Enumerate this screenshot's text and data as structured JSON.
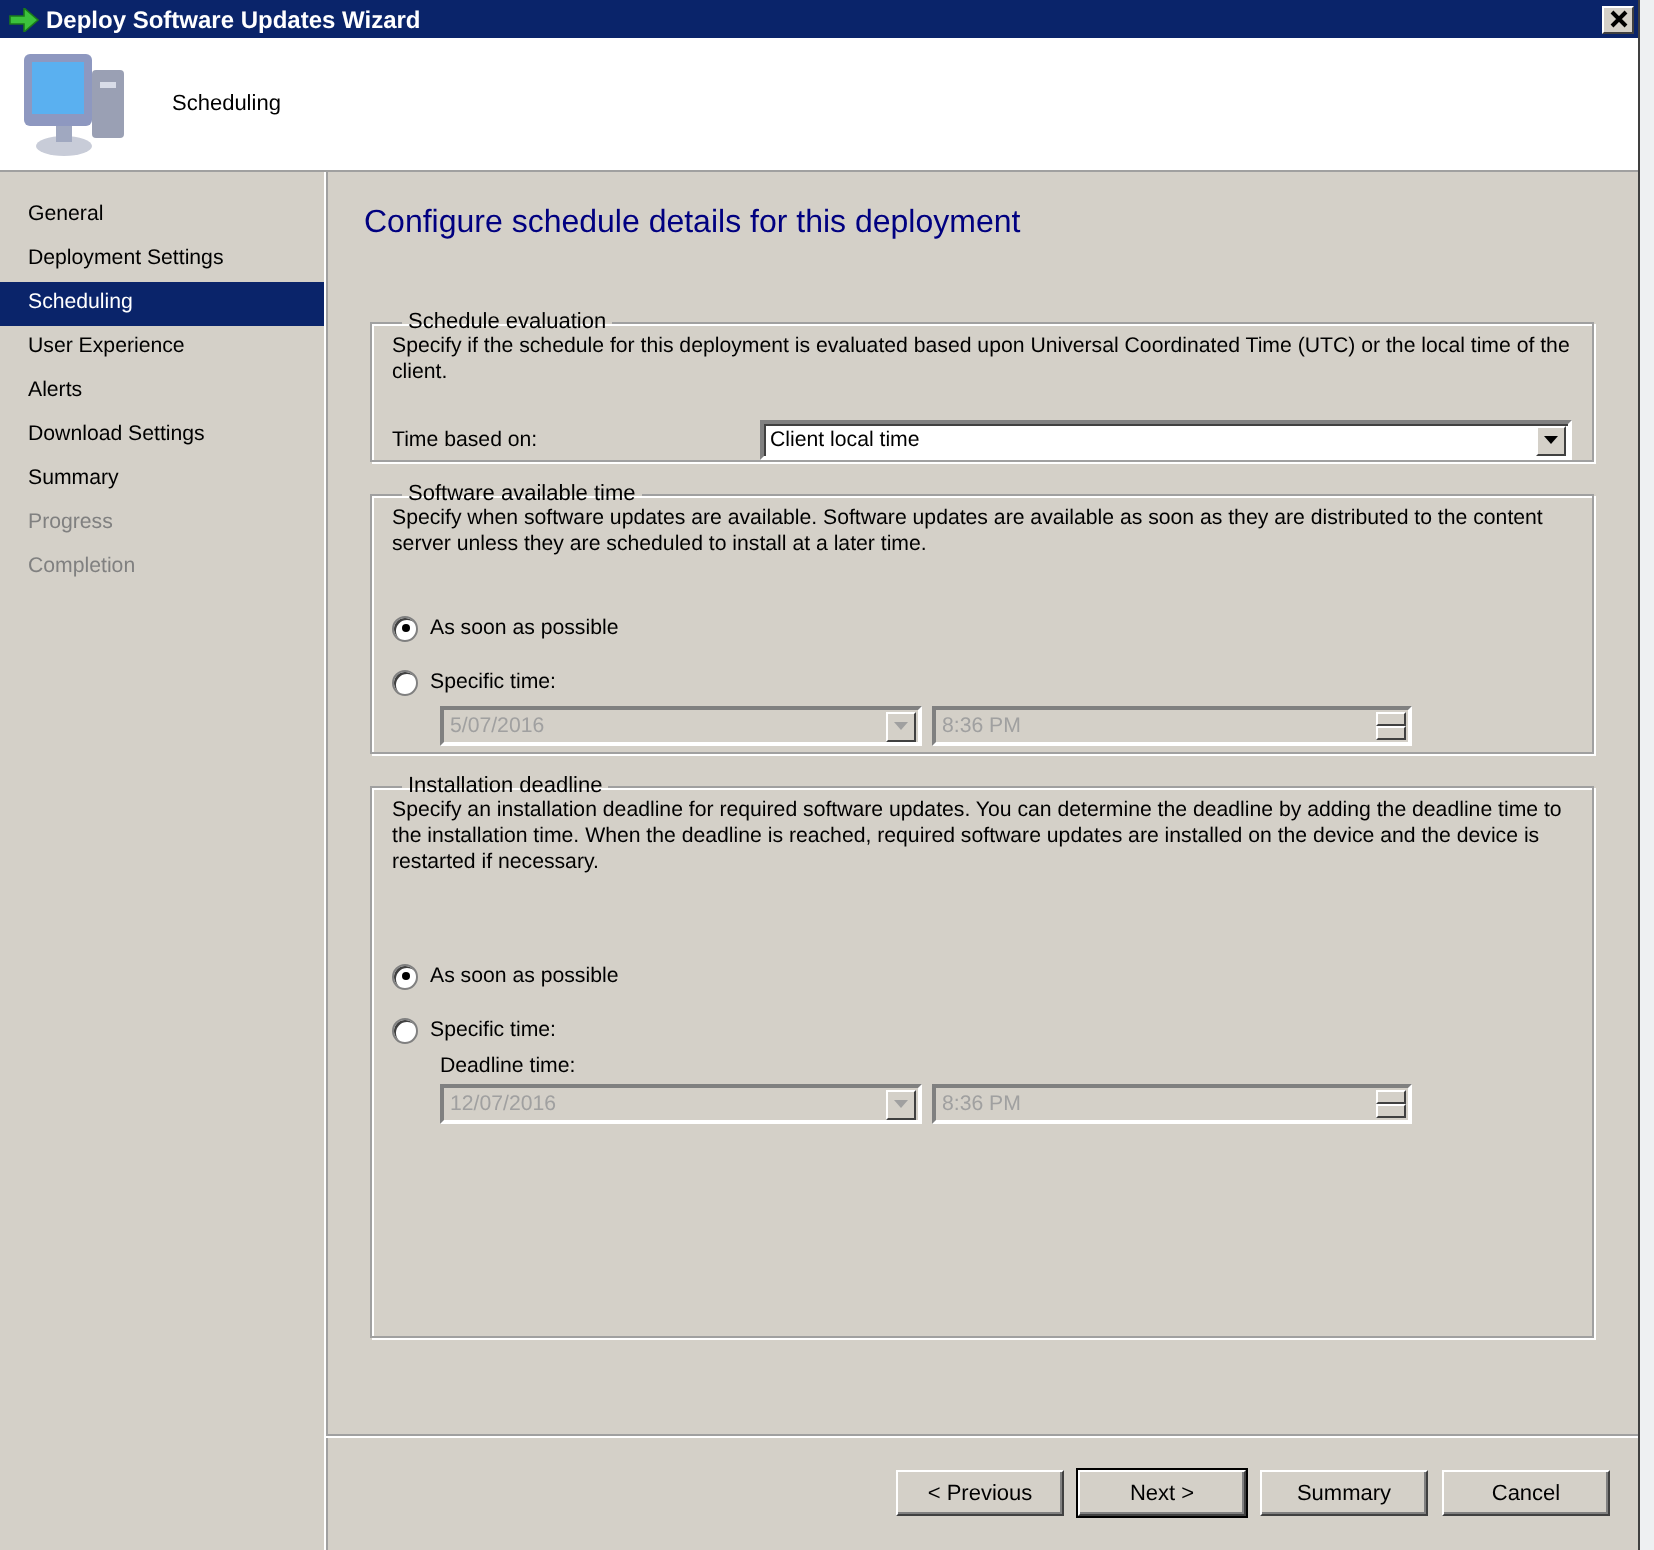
{
  "window": {
    "title": "Deploy Software Updates Wizard"
  },
  "header": {
    "title": "Scheduling"
  },
  "sidebar": {
    "items": [
      {
        "label": "General",
        "selected": false,
        "disabled": false
      },
      {
        "label": "Deployment Settings",
        "selected": false,
        "disabled": false
      },
      {
        "label": "Scheduling",
        "selected": true,
        "disabled": false
      },
      {
        "label": "User Experience",
        "selected": false,
        "disabled": false
      },
      {
        "label": "Alerts",
        "selected": false,
        "disabled": false
      },
      {
        "label": "Download Settings",
        "selected": false,
        "disabled": false
      },
      {
        "label": "Summary",
        "selected": false,
        "disabled": false
      },
      {
        "label": "Progress",
        "selected": false,
        "disabled": true
      },
      {
        "label": "Completion",
        "selected": false,
        "disabled": true
      }
    ]
  },
  "page": {
    "heading": "Configure schedule details for this deployment",
    "groups": [
      {
        "title": "Schedule evaluation",
        "description": "Specify if the schedule for this deployment is evaluated based upon Universal Coordinated Time (UTC) or the local time of the client.",
        "time_based_on": {
          "label": "Time based on:",
          "value": "Client local time",
          "disabled": false
        }
      },
      {
        "title": "Software available time",
        "description": "Specify when software updates are available. Software updates are available as soon as they are distributed to the content server unless they are scheduled to install at a later time.",
        "options": [
          {
            "label": "As soon as possible",
            "selected": true
          },
          {
            "label": "Specific time:",
            "selected": false
          }
        ],
        "date": {
          "value": "5/07/2016",
          "disabled": true
        },
        "time": {
          "value": "8:36 PM",
          "disabled": true
        }
      },
      {
        "title": "Installation deadline",
        "description": "Specify an installation deadline for required software updates. You can determine the deadline by adding the deadline time to the installation time. When the deadline is reached, required software updates are installed on the device and the device is restarted if necessary.",
        "options": [
          {
            "label": "As soon as possible",
            "selected": true
          },
          {
            "label": "Specific time:",
            "selected": false
          }
        ],
        "sub_label": "Deadline time:",
        "date": {
          "value": "12/07/2016",
          "disabled": true
        },
        "time": {
          "value": "8:36 PM",
          "disabled": true
        }
      }
    ]
  },
  "buttons": [
    {
      "label": "< Previous",
      "default": false
    },
    {
      "label": "Next >",
      "default": true
    },
    {
      "label": "Summary",
      "default": false
    },
    {
      "label": "Cancel",
      "default": false
    }
  ]
}
